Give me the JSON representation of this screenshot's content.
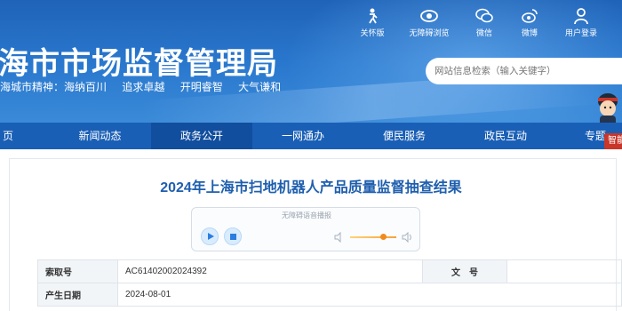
{
  "site": {
    "title": "海市市场监督管理局",
    "motto_parts": [
      "海城市精神：海纳百川",
      "追求卓越",
      "开明睿智",
      "大气谦和"
    ]
  },
  "toolbar": {
    "items": [
      {
        "label": "关怀版",
        "icon": "elder-care-icon"
      },
      {
        "label": "无障碍浏览",
        "icon": "eye-icon"
      },
      {
        "label": "微信",
        "icon": "wechat-icon"
      },
      {
        "label": "微博",
        "icon": "weibo-icon"
      },
      {
        "label": "用户登录",
        "icon": "user-icon"
      }
    ]
  },
  "search": {
    "placeholder": "网站信息检索（输入关键字）"
  },
  "nav": {
    "items": [
      {
        "label": "页"
      },
      {
        "label": "新闻动态"
      },
      {
        "label": "政务公开"
      },
      {
        "label": "一网通办"
      },
      {
        "label": "便民服务"
      },
      {
        "label": "政民互动"
      },
      {
        "label": "专题"
      }
    ],
    "active_index": 2,
    "badge": "智能"
  },
  "article": {
    "title": "2024年上海市扫地机器人产品质量监督抽查结果"
  },
  "player": {
    "label": "无障碍语音播报",
    "volume": 0.72
  },
  "info": {
    "rows": [
      {
        "label": "索取号",
        "value": "AC61402002024392",
        "label2": "文　号",
        "value2": ""
      },
      {
        "label": "产生日期",
        "value": "2024-08-01"
      }
    ]
  },
  "colors": {
    "header_blue": "#2a79cf",
    "nav_blue": "#1a5fb6",
    "nav_active": "#114e9e",
    "title_blue": "#1f5fae",
    "badge_red": "#c9362a"
  }
}
